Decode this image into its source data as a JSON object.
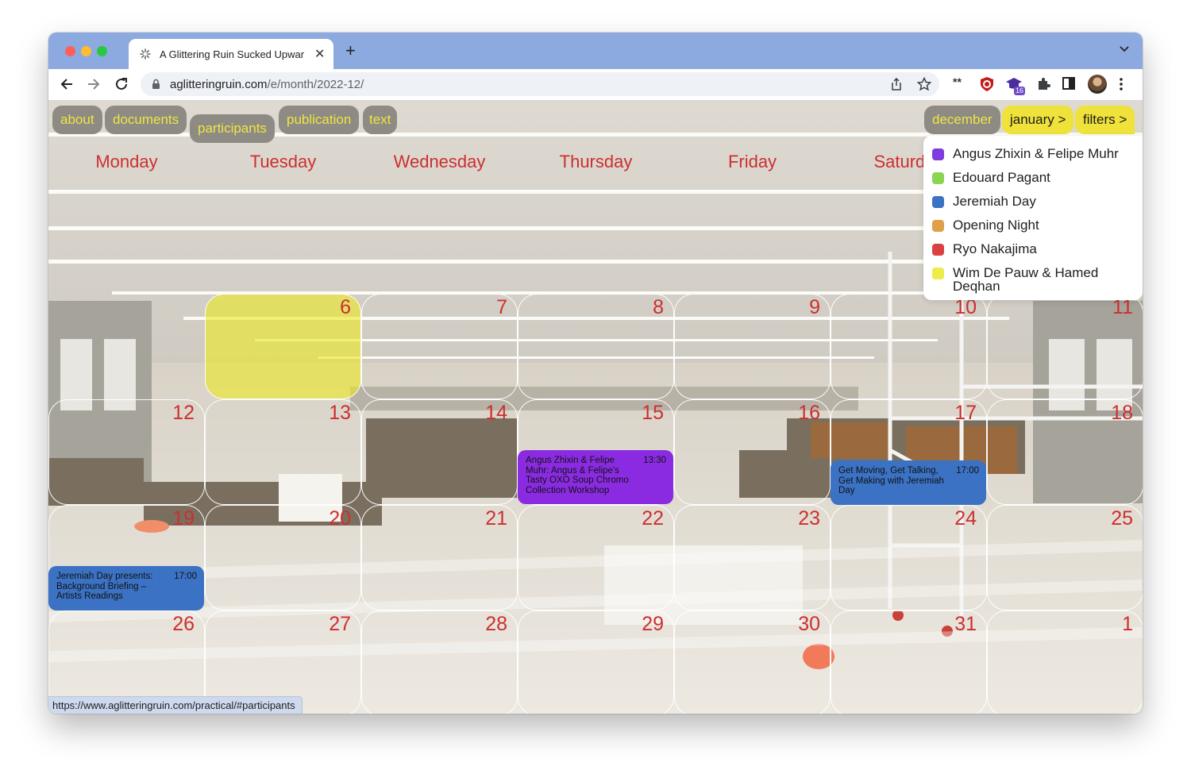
{
  "browser": {
    "tab_title": "A Glittering Ruin Sucked Upwar",
    "url_domain": "aglitteringruin.com",
    "url_path": "/e/month/2022-12/",
    "extension_badge": "16",
    "status_url": "https://www.aglitteringruin.com/practical/#participants"
  },
  "nav": {
    "about": "about",
    "documents": "documents",
    "participants": "participants",
    "publication": "publication",
    "text": "text"
  },
  "month_nav": {
    "current": "december",
    "next": "january >",
    "filters": "filters >"
  },
  "weekdays": [
    "Monday",
    "Tuesday",
    "Wednesday",
    "Thursday",
    "Friday",
    "Saturday"
  ],
  "weeks": [
    [
      "",
      "6",
      "7",
      "8",
      "9",
      "10",
      "11"
    ],
    [
      "12",
      "13",
      "14",
      "15",
      "16",
      "17",
      "18"
    ],
    [
      "19",
      "20",
      "21",
      "22",
      "23",
      "24",
      "25"
    ],
    [
      "26",
      "27",
      "28",
      "29",
      "30",
      "31",
      "1"
    ]
  ],
  "events": [
    {
      "title": "Angus Zhixin & Felipe Muhr: Angus & Felipe's Tasty OXO Soup Chromo Collection Workshop",
      "time": "13:30",
      "color": "#8a2be2"
    },
    {
      "title": "Get Moving, Get Talking, Get Making with Jeremiah Day",
      "time": "17:00",
      "color": "#3b72c4"
    },
    {
      "title": "Jeremiah Day presents: Background Briefing – Artists Readings",
      "time": "17:00",
      "color": "#3b72c4"
    }
  ],
  "filters": [
    {
      "label": "Angus Zhixin & Felipe Muhr",
      "color": "#7f3de0"
    },
    {
      "label": "Edouard Pagant",
      "color": "#8cd453"
    },
    {
      "label": "Jeremiah Day",
      "color": "#3b72c4"
    },
    {
      "label": "Opening Night",
      "color": "#e0a04a"
    },
    {
      "label": "Ryo Nakajima",
      "color": "#dc4141"
    },
    {
      "label": "Wim De Pauw & Hamed Deqhan",
      "color": "#ecec4a"
    }
  ],
  "colors": {
    "accent_red": "#cc2f2f",
    "pill_grey": "#8d8b83",
    "pill_text_yellow": "#f0e544",
    "today_yellow": "#ece828"
  }
}
